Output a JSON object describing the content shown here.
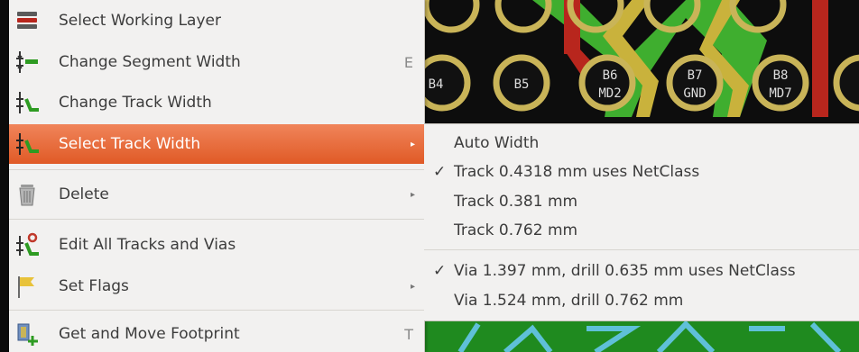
{
  "menu": {
    "items": [
      {
        "label": "Select Working Layer",
        "shortcut": "",
        "submenu": false,
        "active": false,
        "icon": "layers-stack-icon"
      },
      {
        "label": "Change Segment Width",
        "shortcut": "E",
        "submenu": false,
        "active": false,
        "icon": "segment-width-icon"
      },
      {
        "label": "Change Track Width",
        "shortcut": "",
        "submenu": false,
        "active": false,
        "icon": "track-width-icon"
      },
      {
        "label": "Select Track Width",
        "shortcut": "",
        "submenu": true,
        "active": true,
        "icon": "select-track-width-icon"
      },
      {
        "label": "Delete",
        "shortcut": "",
        "submenu": true,
        "active": false,
        "icon": "trash-can-icon"
      },
      {
        "label": "Edit All Tracks and Vias",
        "shortcut": "",
        "submenu": false,
        "active": false,
        "icon": "edit-tracks-vias-icon"
      },
      {
        "label": "Set Flags",
        "shortcut": "",
        "submenu": true,
        "active": false,
        "icon": "flag-icon"
      },
      {
        "label": "Get and Move Footprint",
        "shortcut": "T",
        "submenu": false,
        "active": false,
        "icon": "move-footprint-icon"
      }
    ]
  },
  "submenu": {
    "items": [
      {
        "label": "Auto Width",
        "checked": false
      },
      {
        "label": "Track 0.4318 mm uses NetClass",
        "checked": true
      },
      {
        "label": "Track 0.381 mm",
        "checked": false
      },
      {
        "label": "Track 0.762 mm",
        "checked": false
      },
      {
        "label": "Via 1.397 mm, drill 0.635 mm uses NetClass",
        "checked": true
      },
      {
        "label": "Via 1.524 mm, drill 0.762 mm",
        "checked": false
      }
    ]
  },
  "pcb": {
    "pads": [
      {
        "name": "B4",
        "net": ""
      },
      {
        "name": "B5",
        "net": ""
      },
      {
        "name": "B6",
        "net": "MD2"
      },
      {
        "name": "B7",
        "net": "GND"
      },
      {
        "name": "B8",
        "net": "MD7"
      }
    ],
    "colors": {
      "board": "#0d0d0d",
      "pad": "#c9b458",
      "track_green": "#3fae2f",
      "track_red": "#b8261d",
      "track_yellow": "#c9b23c",
      "accent": "#e8663a"
    }
  }
}
